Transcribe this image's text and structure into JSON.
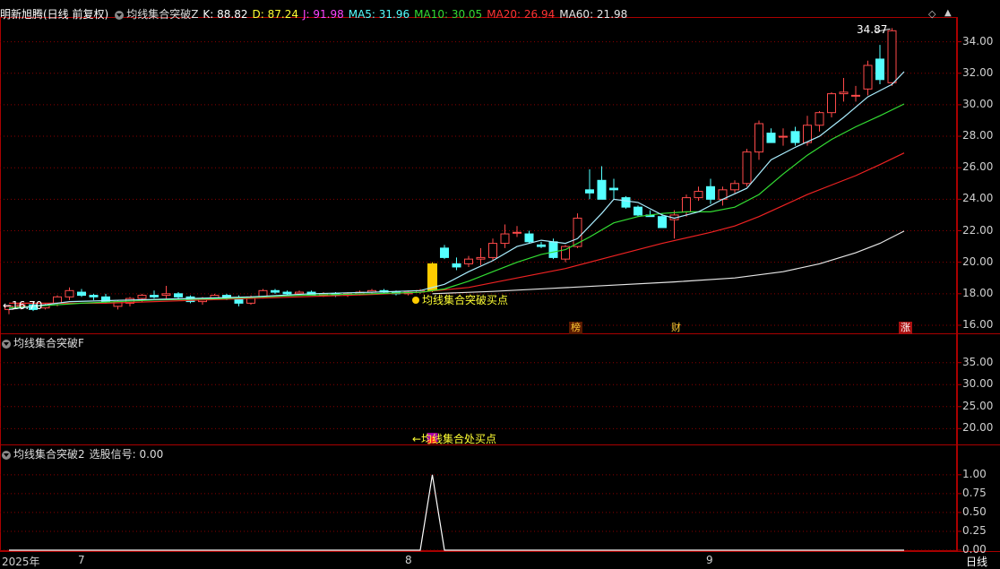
{
  "header_main": {
    "stock": "明新旭腾(日线 前复权)",
    "indicator": "均线集合突破Z",
    "K": "K: 88.82",
    "D": "D: 87.24",
    "J": "J: 91.98",
    "MA5": "MA5: 31.96",
    "MA10": "MA10: 30.05",
    "MA20": "MA20: 26.94",
    "MA60": "MA60: 21.98"
  },
  "header_sub1": {
    "indicator": "均线集合突破F"
  },
  "header_sub2": {
    "indicator": "均线集合突破2",
    "signal": "选股信号: 0.00"
  },
  "annotations": {
    "buy_main": "均线集合突破买点",
    "buy_sub": "←均线集合处买点",
    "low_price": "←16.70",
    "high_price": "34.87",
    "badge_bang": "榜",
    "badge_cai": "财",
    "badge_zhang": "涨"
  },
  "footer": {
    "year": "2025年",
    "m7": "7",
    "m8": "8",
    "m9": "9",
    "period": "日线"
  },
  "colors": {
    "up": "#ff4a4a",
    "down": "#55ffff",
    "ma5": "#ffffff",
    "ma10": "#33dd33",
    "ma20": "#ee2222",
    "ma60": "#e6e6e6",
    "grid": "#8b0000",
    "signal": "#ffff00"
  },
  "chart_data": [
    {
      "type": "candlestick",
      "panel": "main",
      "y_ticks": [
        "16.00",
        "18.00",
        "20.00",
        "22.00",
        "24.00",
        "26.00",
        "28.00",
        "30.00",
        "32.00",
        "34.00"
      ],
      "ylim": [
        15.6,
        35.4
      ],
      "candles": [
        [
          17.0,
          17.3,
          16.7,
          17.2
        ],
        [
          17.2,
          17.4,
          17.0,
          17.3
        ],
        [
          17.3,
          17.5,
          16.9,
          17.0
        ],
        [
          17.1,
          17.4,
          17.0,
          17.3
        ],
        [
          17.4,
          17.9,
          17.2,
          17.8
        ],
        [
          17.8,
          18.4,
          17.6,
          18.2
        ],
        [
          18.1,
          18.3,
          17.8,
          17.9
        ],
        [
          17.9,
          18.0,
          17.6,
          17.8
        ],
        [
          17.8,
          18.0,
          17.4,
          17.5
        ],
        [
          17.2,
          17.6,
          17.0,
          17.5
        ],
        [
          17.4,
          17.8,
          17.2,
          17.7
        ],
        [
          17.7,
          18.0,
          17.5,
          17.9
        ],
        [
          17.9,
          18.2,
          17.7,
          17.8
        ],
        [
          17.9,
          18.5,
          17.7,
          18.0
        ],
        [
          18.0,
          18.1,
          17.7,
          17.8
        ],
        [
          17.8,
          17.9,
          17.4,
          17.5
        ],
        [
          17.5,
          17.8,
          17.3,
          17.7
        ],
        [
          17.7,
          18.0,
          17.6,
          17.9
        ],
        [
          17.9,
          18.0,
          17.6,
          17.7
        ],
        [
          17.7,
          17.9,
          17.2,
          17.4
        ],
        [
          17.4,
          17.9,
          17.3,
          17.8
        ],
        [
          17.8,
          18.3,
          17.7,
          18.2
        ],
        [
          18.2,
          18.3,
          18.0,
          18.1
        ],
        [
          18.1,
          18.2,
          17.9,
          18.0
        ],
        [
          18.0,
          18.2,
          17.9,
          18.1
        ],
        [
          18.1,
          18.2,
          17.9,
          17.9
        ],
        [
          17.9,
          18.1,
          17.8,
          18.0
        ],
        [
          18.0,
          18.1,
          17.8,
          17.9
        ],
        [
          17.9,
          18.1,
          17.8,
          18.0
        ],
        [
          18.0,
          18.2,
          17.9,
          18.1
        ],
        [
          18.1,
          18.3,
          18.0,
          18.2
        ],
        [
          18.2,
          18.3,
          18.0,
          18.1
        ],
        [
          18.1,
          18.2,
          17.9,
          18.0
        ],
        [
          18.0,
          18.2,
          17.9,
          18.1
        ],
        [
          18.1,
          18.3,
          18.0,
          18.2
        ],
        [
          18.2,
          20.0,
          18.1,
          19.9
        ],
        [
          20.9,
          21.1,
          20.2,
          20.3
        ],
        [
          19.9,
          20.3,
          19.5,
          19.7
        ],
        [
          19.9,
          20.4,
          19.7,
          20.2
        ],
        [
          20.2,
          20.9,
          19.8,
          20.3
        ],
        [
          20.3,
          21.5,
          20.1,
          21.2
        ],
        [
          21.2,
          22.4,
          20.9,
          21.8
        ],
        [
          21.9,
          22.3,
          21.6,
          21.9
        ],
        [
          21.8,
          22.0,
          21.2,
          21.3
        ],
        [
          21.1,
          21.3,
          20.9,
          21.0
        ],
        [
          21.3,
          21.5,
          20.2,
          20.3
        ],
        [
          20.2,
          21.1,
          20.0,
          21.0
        ],
        [
          21.0,
          23.1,
          20.9,
          22.8
        ],
        [
          24.6,
          25.9,
          24.0,
          24.4
        ],
        [
          25.2,
          26.1,
          24.0,
          24.0
        ],
        [
          24.7,
          25.3,
          24.0,
          24.6
        ],
        [
          24.1,
          24.2,
          23.4,
          23.5
        ],
        [
          23.5,
          23.6,
          22.9,
          23.0
        ],
        [
          23.0,
          23.3,
          22.9,
          22.9
        ],
        [
          22.9,
          23.1,
          22.3,
          22.2
        ],
        [
          22.7,
          23.3,
          21.5,
          23.0
        ],
        [
          23.2,
          24.3,
          22.9,
          24.1
        ],
        [
          24.1,
          24.8,
          23.9,
          24.5
        ],
        [
          24.8,
          25.3,
          23.7,
          24.0
        ],
        [
          24.0,
          24.8,
          23.6,
          24.6
        ],
        [
          24.6,
          25.2,
          24.4,
          25.0
        ],
        [
          25.0,
          27.2,
          24.8,
          27.0
        ],
        [
          27.0,
          29.0,
          26.5,
          28.8
        ],
        [
          28.2,
          28.5,
          27.6,
          27.6
        ],
        [
          28.0,
          28.5,
          27.4,
          28.0
        ],
        [
          28.3,
          28.6,
          27.4,
          27.6
        ],
        [
          27.6,
          29.3,
          27.4,
          28.7
        ],
        [
          28.7,
          29.6,
          28.3,
          29.5
        ],
        [
          29.5,
          30.8,
          29.2,
          30.7
        ],
        [
          30.7,
          31.7,
          30.2,
          30.8
        ],
        [
          30.6,
          31.2,
          30.2,
          30.6
        ],
        [
          31.0,
          32.8,
          30.6,
          32.5
        ],
        [
          32.9,
          33.8,
          31.3,
          31.6
        ],
        [
          31.4,
          34.87,
          31.2,
          34.7
        ]
      ],
      "ma5": [
        [
          0,
          17.0
        ],
        [
          5,
          17.5
        ],
        [
          10,
          17.6
        ],
        [
          15,
          17.7
        ],
        [
          20,
          17.8
        ],
        [
          25,
          18.0
        ],
        [
          30,
          18.1
        ],
        [
          34,
          18.2
        ],
        [
          36,
          18.6
        ],
        [
          38,
          19.4
        ],
        [
          40,
          20.1
        ],
        [
          42,
          21.0
        ],
        [
          44,
          21.4
        ],
        [
          46,
          21.2
        ],
        [
          47,
          21.5
        ],
        [
          49,
          23.1
        ],
        [
          50,
          24.0
        ],
        [
          52,
          23.8
        ],
        [
          54,
          23.0
        ],
        [
          55,
          22.8
        ],
        [
          57,
          23.2
        ],
        [
          59,
          24.0
        ],
        [
          61,
          24.7
        ],
        [
          63,
          26.5
        ],
        [
          65,
          27.3
        ],
        [
          67,
          28.0
        ],
        [
          69,
          29.2
        ],
        [
          71,
          30.5
        ],
        [
          72,
          30.9
        ],
        [
          73,
          31.3
        ],
        [
          74,
          32.1
        ]
      ],
      "ma10": [
        [
          0,
          17.1
        ],
        [
          6,
          17.4
        ],
        [
          12,
          17.6
        ],
        [
          18,
          17.7
        ],
        [
          24,
          17.9
        ],
        [
          30,
          18.0
        ],
        [
          34,
          18.1
        ],
        [
          36,
          18.3
        ],
        [
          38,
          18.8
        ],
        [
          40,
          19.4
        ],
        [
          42,
          20.0
        ],
        [
          44,
          20.5
        ],
        [
          46,
          20.8
        ],
        [
          48,
          21.6
        ],
        [
          50,
          22.5
        ],
        [
          52,
          22.9
        ],
        [
          54,
          23.1
        ],
        [
          56,
          23.2
        ],
        [
          58,
          23.2
        ],
        [
          60,
          23.5
        ],
        [
          62,
          24.3
        ],
        [
          64,
          25.6
        ],
        [
          66,
          26.8
        ],
        [
          68,
          27.8
        ],
        [
          70,
          28.6
        ],
        [
          72,
          29.3
        ],
        [
          74,
          30.05
        ]
      ],
      "ma20": [
        [
          0,
          17.4
        ],
        [
          8,
          17.4
        ],
        [
          16,
          17.6
        ],
        [
          24,
          17.8
        ],
        [
          30,
          17.95
        ],
        [
          34,
          18.1
        ],
        [
          38,
          18.4
        ],
        [
          42,
          19.0
        ],
        [
          46,
          19.6
        ],
        [
          50,
          20.4
        ],
        [
          54,
          21.2
        ],
        [
          58,
          21.9
        ],
        [
          60,
          22.3
        ],
        [
          62,
          22.9
        ],
        [
          64,
          23.6
        ],
        [
          66,
          24.3
        ],
        [
          68,
          24.9
        ],
        [
          70,
          25.5
        ],
        [
          72,
          26.2
        ],
        [
          74,
          26.94
        ]
      ],
      "ma60": [
        [
          35,
          18.0
        ],
        [
          40,
          18.15
        ],
        [
          45,
          18.35
        ],
        [
          50,
          18.55
        ],
        [
          55,
          18.75
        ],
        [
          60,
          19.0
        ],
        [
          64,
          19.4
        ],
        [
          67,
          19.9
        ],
        [
          70,
          20.6
        ],
        [
          72,
          21.2
        ],
        [
          74,
          21.98
        ]
      ],
      "buy_index": 35
    },
    {
      "type": "scatter",
      "panel": "sub1",
      "y_ticks": [
        "20.00",
        "25.00",
        "30.00",
        "35.00"
      ],
      "ylim": [
        16.6,
        38.0
      ],
      "points": [
        {
          "x": 35,
          "y": 18.0,
          "marker": "square"
        },
        {
          "x": 35,
          "y": 16.6,
          "marker": "triangle"
        }
      ]
    },
    {
      "type": "line",
      "panel": "sub2",
      "y_ticks": [
        "0.00",
        "0.25",
        "0.50",
        "0.75",
        "1.00"
      ],
      "ylim": [
        0,
        1.2
      ],
      "values": [
        [
          0,
          0
        ],
        [
          34,
          0
        ],
        [
          35,
          1
        ],
        [
          36,
          0
        ],
        [
          74,
          0
        ]
      ]
    }
  ]
}
